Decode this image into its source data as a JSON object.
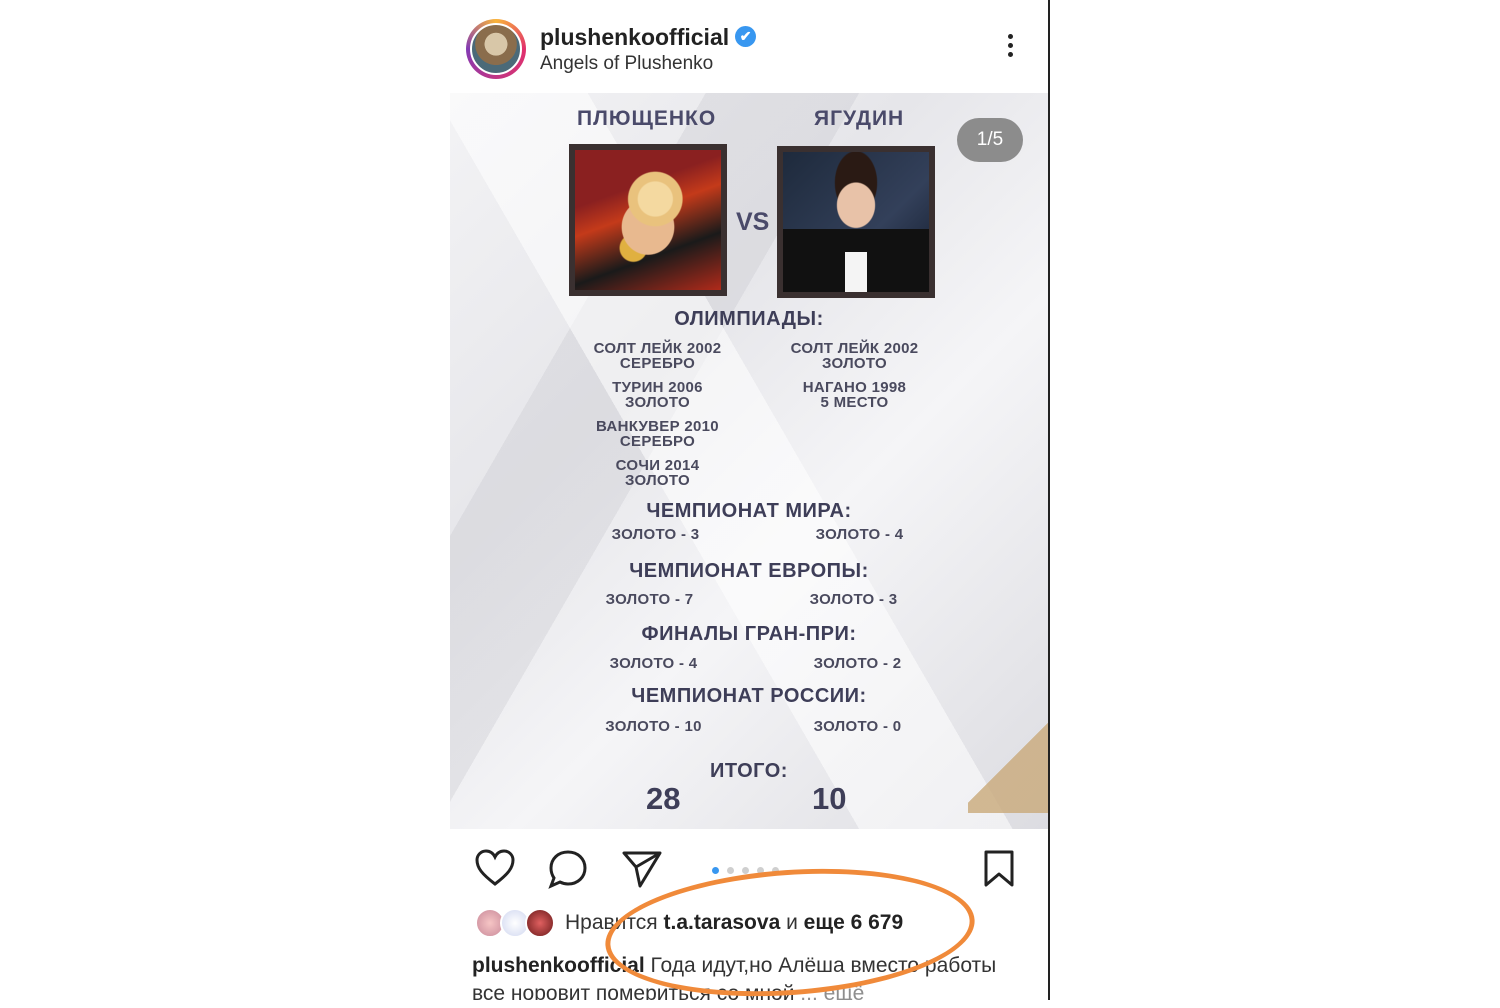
{
  "header": {
    "username": "plushenkoofficial",
    "verified_icon": "✔",
    "subtitle": "Angels of Plushenko"
  },
  "post": {
    "pager": "1/5",
    "left_name": "ПЛЮЩЕНКО",
    "right_name": "ЯГУДИН",
    "vs": "VS",
    "sections": {
      "olympics": "ОЛИМПИАДЫ:",
      "worlds": "ЧЕМПИОНАТ МИРА:",
      "europe": "ЧЕМПИОНАТ ЕВРОПЫ:",
      "gp": "ФИНАЛЫ ГРАН-ПРИ:",
      "russia": "ЧЕМПИОНАТ РОССИИ:",
      "total": "ИТОГО:"
    },
    "olympics_left": [
      [
        "СОЛТ ЛЕЙК 2002",
        "СЕРЕБРО"
      ],
      [
        "ТУРИН 2006",
        "ЗОЛОТО"
      ],
      [
        "ВАНКУВЕР 2010",
        "СЕРЕБРО"
      ],
      [
        "СОЧИ 2014",
        "ЗОЛОТО"
      ]
    ],
    "olympics_right": [
      [
        "СОЛТ ЛЕЙК 2002",
        "ЗОЛОТО"
      ],
      [
        "НАГАНО 1998",
        "5 МЕСТО"
      ]
    ],
    "worlds_left": "ЗОЛОТО - 3",
    "worlds_right": "ЗОЛОТО - 4",
    "europe_left": "ЗОЛОТО - 7",
    "europe_right": "ЗОЛОТО - 3",
    "gp_left": "ЗОЛОТО - 4",
    "gp_right": "ЗОЛОТО - 2",
    "russia_left": "ЗОЛОТО - 10",
    "russia_right": "ЗОЛОТО - 0",
    "total_left": "28",
    "total_right": "10"
  },
  "actions": {
    "like_icon": "heart-icon",
    "comment_icon": "comment-icon",
    "share_icon": "send-icon",
    "save_icon": "bookmark-icon",
    "carousel_index": 1,
    "carousel_count": 5
  },
  "likes": {
    "prefix": "Нравится",
    "user": "t.a.tarasova",
    "mid": "и",
    "suffix": "еще 6 679"
  },
  "caption": {
    "username": "plushenkoofficial",
    "text": "Года идут,но Алёша вместо работы все норовит помериться со мной",
    "more": "... ещё"
  },
  "colors": {
    "accent": "#3897f0",
    "annotation": "#f08a3a"
  }
}
